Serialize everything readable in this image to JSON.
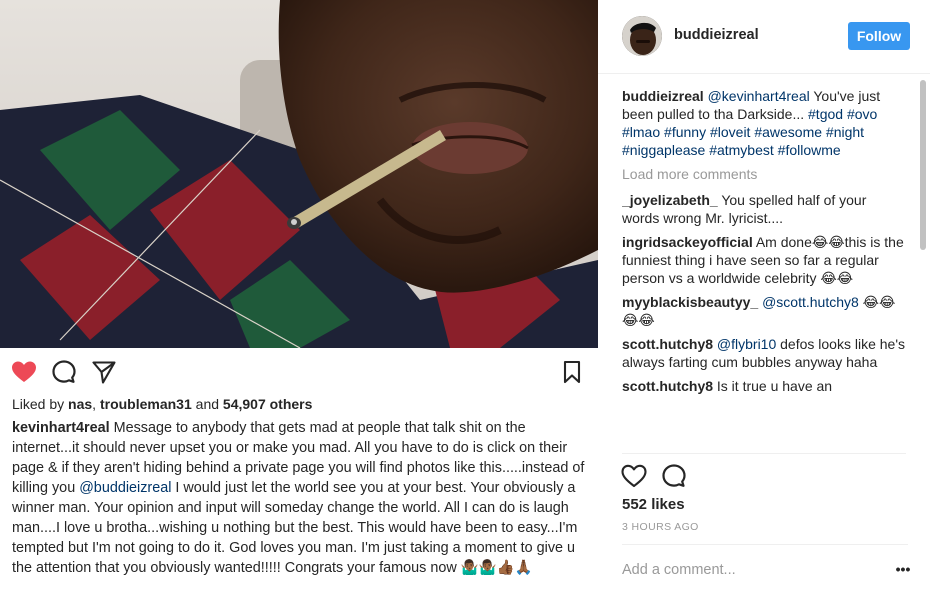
{
  "post": {
    "author": "buddieizreal",
    "follow_label": "Follow",
    "image_alt": "photo"
  },
  "comments": [
    {
      "user": "buddieizreal",
      "parts": [
        {
          "t": " "
        },
        {
          "t": "@kevinhart4real",
          "k": "mention"
        },
        {
          "t": " You've just been pulled to tha Darkside... "
        },
        {
          "t": "#tgod",
          "k": "tag"
        },
        {
          "t": " "
        },
        {
          "t": "#ovo",
          "k": "tag"
        },
        {
          "t": " "
        },
        {
          "t": "#lmao",
          "k": "tag"
        },
        {
          "t": " "
        },
        {
          "t": "#funny",
          "k": "tag"
        },
        {
          "t": " "
        },
        {
          "t": "#loveit",
          "k": "tag"
        },
        {
          "t": " "
        },
        {
          "t": "#awesome",
          "k": "tag"
        },
        {
          "t": " "
        },
        {
          "t": "#night",
          "k": "tag"
        },
        {
          "t": " "
        },
        {
          "t": "#niggaplease",
          "k": "tag"
        },
        {
          "t": " "
        },
        {
          "t": "#atmybest",
          "k": "tag"
        },
        {
          "t": " "
        },
        {
          "t": "#followme",
          "k": "tag"
        }
      ]
    },
    {
      "user": "_joyelizabeth_",
      "parts": [
        {
          "t": " You spelled half of your words wrong Mr. lyricist...."
        }
      ]
    },
    {
      "user": "ingridsackeyofficial",
      "parts": [
        {
          "t": " Am done😂😂this is the funniest thing i have seen so far a regular person vs a worldwide celebrity 😂😂"
        }
      ]
    },
    {
      "user": "myyblackisbeautyy_",
      "parts": [
        {
          "t": " "
        },
        {
          "t": "@scott.hutchy8",
          "k": "mention"
        },
        {
          "t": " 😂😂😂😂"
        }
      ]
    },
    {
      "user": "scott.hutchy8",
      "parts": [
        {
          "t": " "
        },
        {
          "t": "@flybri10",
          "k": "mention"
        },
        {
          "t": " defos looks like he's always farting cum bubbles anyway haha"
        }
      ]
    },
    {
      "user": "scott.hutchy8",
      "parts": [
        {
          "t": " Is it true u have an"
        }
      ]
    }
  ],
  "load_more_label": "Load more comments",
  "likes_right": "552 likes",
  "time_ago": "3 HOURS AGO",
  "add_comment_placeholder": "Add a comment...",
  "more_label": "•••",
  "left_panel": {
    "liked_by_prefix": "Liked by ",
    "liked_user1": "nas",
    "liked_sep": ", ",
    "liked_user2": "troubleman31",
    "liked_and": " and ",
    "liked_count": "54,907 others",
    "caption_user": "kevinhart4real",
    "caption_part1": " Message to anybody that gets mad at people that talk shit on the internet...it should never upset you or make you mad. All you have to do is click on their page & if they aren't hiding behind a private page you will find photos like this.....instead of killing you ",
    "caption_mention": "@buddieizreal",
    "caption_part2": " I would just let the world see you at your best. Your obviously a winner man. Your opinion and input will someday change the world. All I can do is laugh man....I love u brotha...wishing u nothing but the best. This would have been to easy...I'm tempted but I'm not going to do it. God loves you man. I'm just taking a moment to give u the attention that you obviously wanted!!!!! Congrats your famous now 🤷🏾‍♂️🤷🏾‍♂️👍🏾🙏🏾"
  },
  "colors": {
    "heart_liked": "#ed4956",
    "follow_button": "#3897f0",
    "link": "#003569",
    "muted": "#999999"
  },
  "icons": {
    "like": "heart-icon",
    "comment": "comment-icon",
    "share": "share-icon",
    "save": "bookmark-icon"
  }
}
